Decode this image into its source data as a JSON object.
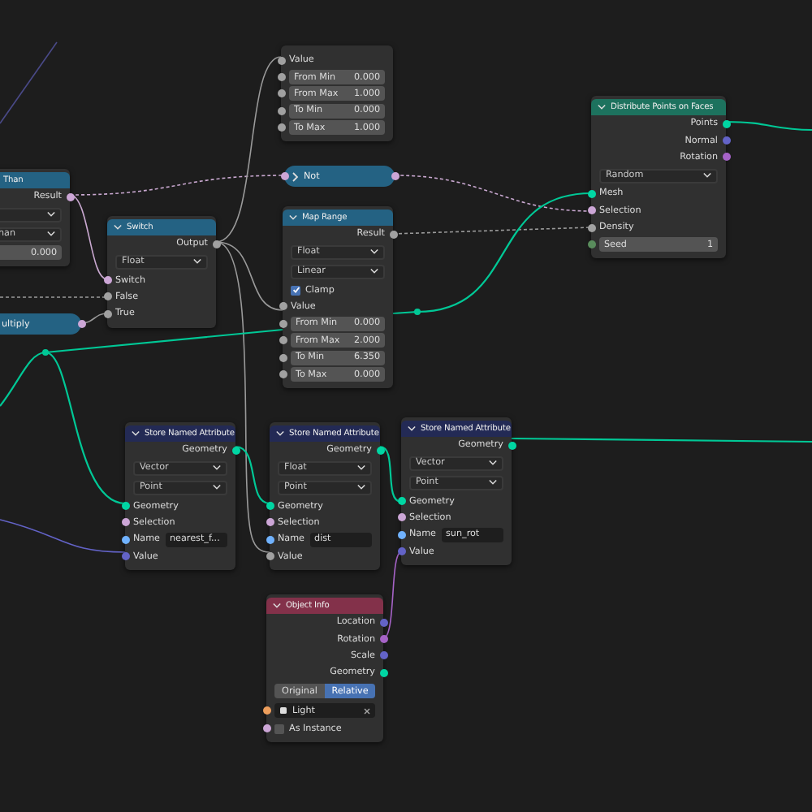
{
  "nodes": [
    {
      "rows": [
        {
          "kind": "input",
          "label": "Value",
          "color": "#a1a1a1"
        },
        {
          "kind": "field",
          "label": "From Min",
          "value": "0.000",
          "color": "#a1a1a1"
        },
        {
          "kind": "field",
          "label": "From Max",
          "value": "1.000",
          "color": "#a1a1a1"
        },
        {
          "kind": "field",
          "label": "To Min",
          "value": "0.000",
          "color": "#a1a1a1"
        },
        {
          "kind": "field",
          "label": "To Max",
          "value": "1.000",
          "color": "#a1a1a1"
        }
      ]
    },
    {
      "title": "Than",
      "color": "#246283",
      "rows": [
        {
          "kind": "output",
          "label": "Result",
          "color": "#cca6d6"
        },
        {
          "kind": "dropdown"
        },
        {
          "kind": "dropdown",
          "value": "han"
        },
        {
          "kind": "field",
          "value": "0.000"
        }
      ]
    },
    {
      "title": "Switch",
      "color": "#246283",
      "rows": [
        {
          "kind": "output",
          "label": "Output",
          "color": "#a1a1a1"
        },
        {
          "kind": "dropdown",
          "value": "Float"
        },
        {
          "kind": "input",
          "label": "Switch",
          "color": "#cca6d6"
        },
        {
          "kind": "input",
          "label": "False",
          "color": "#a1a1a1"
        },
        {
          "kind": "input",
          "label": "True",
          "color": "#a1a1a1"
        }
      ]
    },
    {
      "title": "Not",
      "color": "#246283",
      "collapsed": true
    },
    {
      "title": "ultiply",
      "color": "#246283",
      "collapsed": true
    },
    {
      "title": "Map Range",
      "color": "#246283",
      "rows": [
        {
          "kind": "output",
          "label": "Result",
          "color": "#a1a1a1"
        },
        {
          "kind": "dropdown",
          "value": "Float"
        },
        {
          "kind": "dropdown",
          "value": "Linear"
        },
        {
          "kind": "checkbox",
          "label": "Clamp",
          "checked": true
        },
        {
          "kind": "input",
          "label": "Value",
          "color": "#a1a1a1"
        },
        {
          "kind": "field",
          "label": "From Min",
          "value": "0.000",
          "color": "#a1a1a1"
        },
        {
          "kind": "field",
          "label": "From Max",
          "value": "2.000",
          "color": "#a1a1a1"
        },
        {
          "kind": "field",
          "label": "To Min",
          "value": "6.350",
          "color": "#a1a1a1"
        },
        {
          "kind": "field",
          "label": "To Max",
          "value": "0.000",
          "color": "#a1a1a1"
        }
      ]
    },
    {
      "title": "Distribute Points on Faces",
      "color": "#1d725e",
      "rows": [
        {
          "kind": "output",
          "label": "Points",
          "color": "#00d6a3"
        },
        {
          "kind": "output",
          "label": "Normal",
          "color": "#6363c7"
        },
        {
          "kind": "output",
          "label": "Rotation",
          "color": "#a663c7"
        },
        {
          "kind": "dropdown",
          "value": "Random"
        },
        {
          "kind": "input",
          "label": "Mesh",
          "color": "#00d6a3"
        },
        {
          "kind": "input",
          "label": "Selection",
          "color": "#cca6d6"
        },
        {
          "kind": "input",
          "label": "Density",
          "color": "#a1a1a1"
        },
        {
          "kind": "field",
          "label": "Seed",
          "value": "1",
          "color": "#598c5c"
        }
      ]
    },
    {
      "title": "Store Named Attribute",
      "color": "#232a55",
      "rows": [
        {
          "kind": "output",
          "label": "Geometry",
          "color": "#00d6a3"
        },
        {
          "kind": "dropdown",
          "value": "Vector"
        },
        {
          "kind": "dropdown",
          "value": "Point"
        },
        {
          "kind": "input",
          "label": "Geometry",
          "color": "#00d6a3"
        },
        {
          "kind": "input",
          "label": "Selection",
          "color": "#cca6d6"
        },
        {
          "kind": "text",
          "label": "Name",
          "value": "nearest_f...",
          "color": "#70b2ff"
        },
        {
          "kind": "input",
          "label": "Value",
          "color": "#6363c7"
        }
      ]
    },
    {
      "title": "Store Named Attribute",
      "color": "#232a55",
      "rows": [
        {
          "kind": "output",
          "label": "Geometry",
          "color": "#00d6a3"
        },
        {
          "kind": "dropdown",
          "value": "Float"
        },
        {
          "kind": "dropdown",
          "value": "Point"
        },
        {
          "kind": "input",
          "label": "Geometry",
          "color": "#00d6a3"
        },
        {
          "kind": "input",
          "label": "Selection",
          "color": "#cca6d6"
        },
        {
          "kind": "text",
          "label": "Name",
          "value": "dist",
          "color": "#70b2ff"
        },
        {
          "kind": "input",
          "label": "Value",
          "color": "#a1a1a1"
        }
      ]
    },
    {
      "title": "Store Named Attribute",
      "color": "#232a55",
      "rows": [
        {
          "kind": "output",
          "label": "Geometry",
          "color": "#00d6a3"
        },
        {
          "kind": "dropdown",
          "value": "Vector"
        },
        {
          "kind": "dropdown",
          "value": "Point"
        },
        {
          "kind": "input",
          "label": "Geometry",
          "color": "#00d6a3"
        },
        {
          "kind": "input",
          "label": "Selection",
          "color": "#cca6d6"
        },
        {
          "kind": "text",
          "label": "Name",
          "value": "sun_rot",
          "color": "#70b2ff"
        },
        {
          "kind": "input",
          "label": "Value",
          "color": "#6363c7"
        }
      ]
    },
    {
      "title": "Object Info",
      "color": "#83314a",
      "rows": [
        {
          "kind": "output",
          "label": "Location",
          "color": "#6363c7"
        },
        {
          "kind": "output",
          "label": "Rotation",
          "color": "#a663c7"
        },
        {
          "kind": "output",
          "label": "Scale",
          "color": "#6363c7"
        },
        {
          "kind": "output",
          "label": "Geometry",
          "color": "#00d6a3"
        },
        {
          "kind": "toggle",
          "options": [
            {
              "label": "Original",
              "selected": false
            },
            {
              "label": "Relative",
              "selected": true
            }
          ]
        },
        {
          "kind": "object",
          "value": "Light",
          "color": "#ed9e5c"
        },
        {
          "kind": "checkbox",
          "label": "As Instance",
          "checked": false,
          "color": "#cca6d6"
        }
      ]
    }
  ]
}
